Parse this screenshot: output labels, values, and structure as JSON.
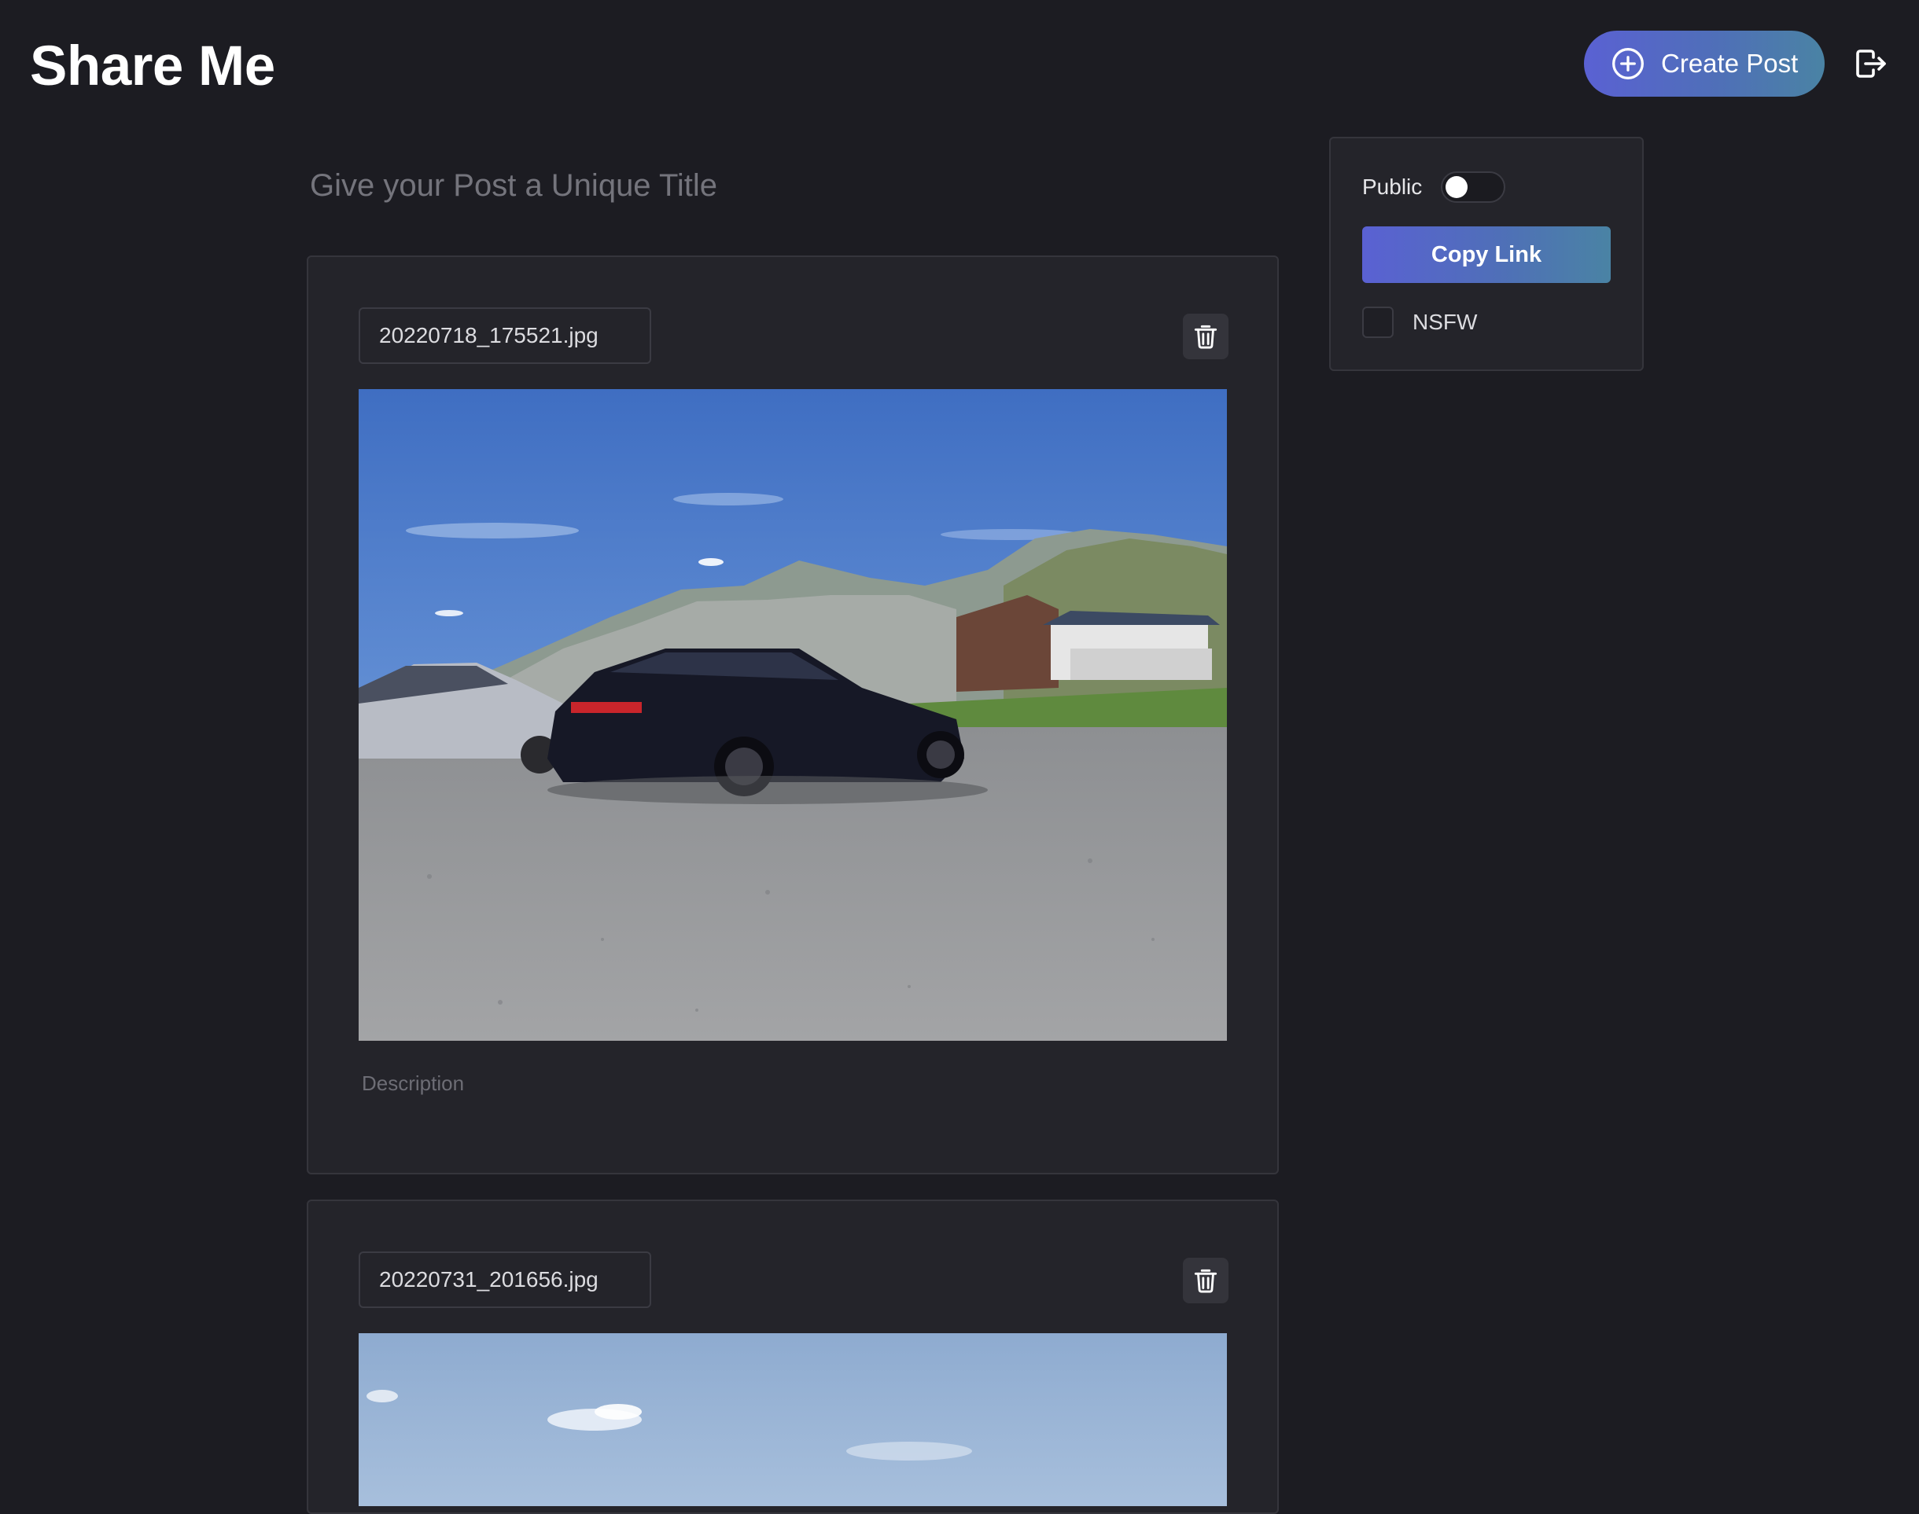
{
  "header": {
    "logo": "Share Me",
    "create_post_label": "Create Post",
    "create_icon": "plus-circle-icon",
    "logout_icon": "logout-icon"
  },
  "post": {
    "title_placeholder": "Give your Post a Unique Title",
    "title_value": ""
  },
  "images": [
    {
      "filename": "20220718_175521.jpg",
      "description_placeholder": "Description",
      "description_value": "",
      "delete_icon": "trash-icon"
    },
    {
      "filename": "20220731_201656.jpg",
      "delete_icon": "trash-icon"
    }
  ],
  "settings": {
    "public_label": "Public",
    "public_enabled": false,
    "copy_link_label": "Copy Link",
    "nsfw_label": "NSFW",
    "nsfw_checked": false
  },
  "colors": {
    "background": "#1c1c22",
    "card": "#24242a",
    "accent_start": "#5a61d3",
    "accent_end": "#4a83a4"
  }
}
